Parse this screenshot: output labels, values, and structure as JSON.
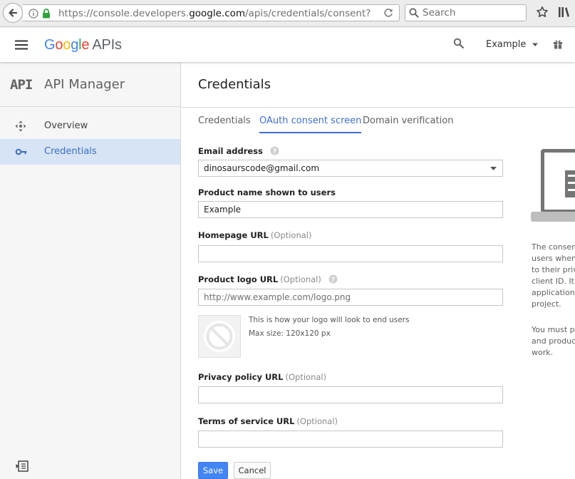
{
  "browser": {
    "url_prefix": "https://console.developers.",
    "url_host": "google.com",
    "url_suffix": "/apis/credentials/consent?",
    "search_placeholder": "Search"
  },
  "header": {
    "logo_google": "Google",
    "logo_suffix": "APIs",
    "project_name": "Example",
    "logo_colors": [
      "#4285f4",
      "#ea4335",
      "#fbbc05",
      "#4285f4",
      "#34a853",
      "#ea4335"
    ]
  },
  "sidebar": {
    "logo": "API",
    "title": "API Manager",
    "items": [
      {
        "label": "Overview",
        "icon": "move-icon",
        "active": false
      },
      {
        "label": "Credentials",
        "icon": "key-icon",
        "active": true
      }
    ]
  },
  "main": {
    "title": "Credentials",
    "tabs": [
      {
        "label": "Credentials",
        "active": false
      },
      {
        "label": "OAuth consent screen",
        "active": true
      },
      {
        "label": "Domain verification",
        "active": false
      }
    ],
    "optional_label": "(Optional)",
    "fields": {
      "email": {
        "label": "Email address",
        "value": "dinosaurscode@gmail.com"
      },
      "product_name": {
        "label": "Product name shown to users",
        "value": "Example"
      },
      "homepage": {
        "label": "Homepage URL",
        "value": ""
      },
      "logo_url": {
        "label": "Product logo URL",
        "value": "",
        "placeholder": "http://www.example.com/logo.png"
      },
      "privacy": {
        "label": "Privacy policy URL",
        "value": ""
      },
      "terms": {
        "label": "Terms of service URL",
        "value": ""
      }
    },
    "logo_hint": "This is how your logo will look to end users",
    "logo_max": "Max size: 120x120 px",
    "save_label": "Save",
    "cancel_label": "Cancel",
    "side_text_lines": [
      "The consen",
      "users when",
      "to their priv",
      "client ID. It",
      "application",
      "project."
    ],
    "side_text2_lines": [
      "You must p",
      "and produc",
      "work."
    ]
  },
  "colors": {
    "accent": "#3f6ed2",
    "active_nav_bg": "#d7e4f6",
    "save_button": "#4285f4"
  }
}
